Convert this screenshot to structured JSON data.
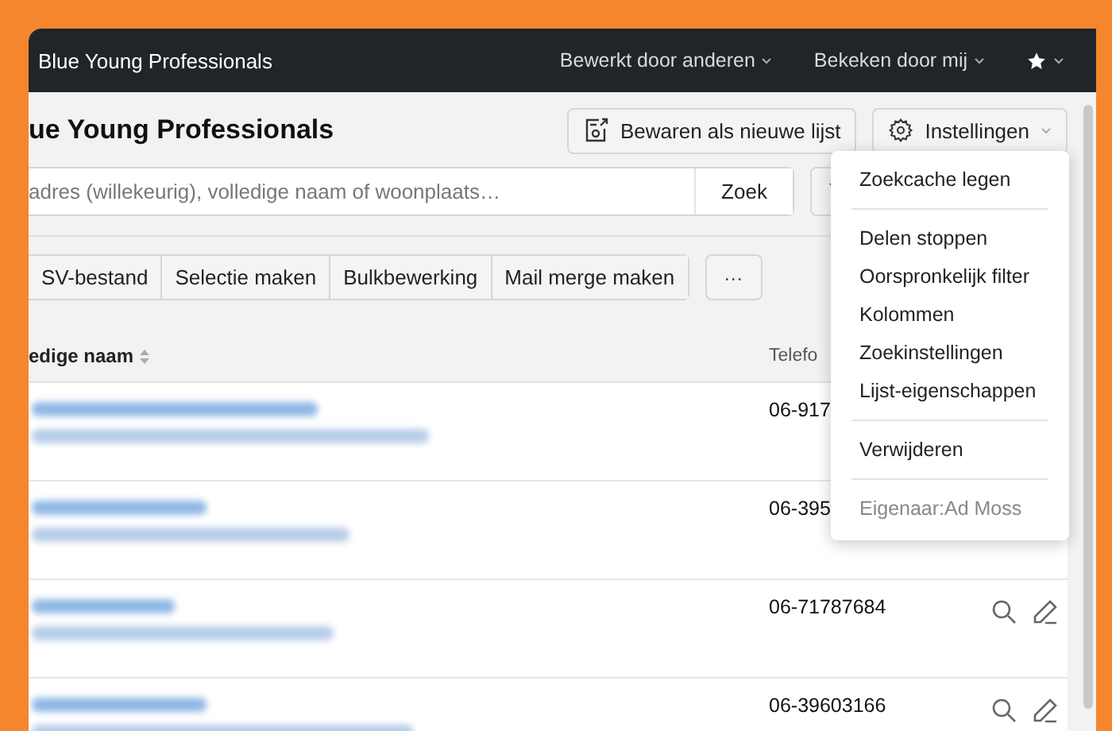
{
  "window": {
    "title": "Blue Young Professionals"
  },
  "nav": [
    {
      "label": "Bewerkt door anderen"
    },
    {
      "label": "Bekeken door mij"
    }
  ],
  "page": {
    "title": "ue Young Professionals",
    "save_button": "Bewaren als nieuwe lijst",
    "settings_button": "Instellingen"
  },
  "search": {
    "placeholder": "adres (willekeurig), volledige naam of woonplaats…",
    "button": "Zoek"
  },
  "toolbar": [
    "SV-bestand",
    "Selectie maken",
    "Bulkbewerking",
    "Mail merge maken"
  ],
  "more_button": "···",
  "table": {
    "columns": [
      "edige naam",
      "Telefo"
    ],
    "rows": [
      {
        "phone": "06-917"
      },
      {
        "phone": "06-395"
      },
      {
        "phone": "06-71787684"
      },
      {
        "phone": "06-39603166"
      }
    ]
  },
  "menu": {
    "items": [
      {
        "kind": "item",
        "label": "Zoekcache legen"
      },
      {
        "kind": "separator"
      },
      {
        "kind": "item",
        "label": "Delen stoppen"
      },
      {
        "kind": "item",
        "label": "Oorspronkelijk filter"
      },
      {
        "kind": "item",
        "label": "Kolommen"
      },
      {
        "kind": "item",
        "label": "Zoekinstellingen"
      },
      {
        "kind": "item",
        "label": "Lijst-eigenschappen"
      },
      {
        "kind": "separator"
      },
      {
        "kind": "item",
        "label": "Verwijderen"
      },
      {
        "kind": "separator"
      },
      {
        "kind": "note",
        "label": "Eigenaar:Ad Moss"
      }
    ]
  }
}
